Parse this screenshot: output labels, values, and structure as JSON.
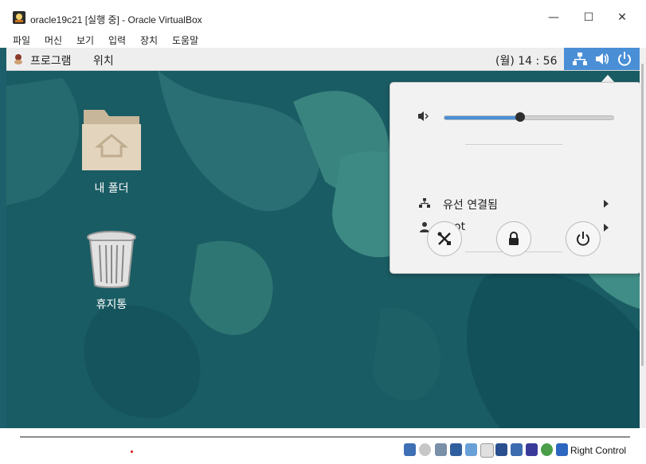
{
  "window": {
    "title": "oracle19c21 [실행 중] - Oracle VirtualBox",
    "controls": {
      "minimize": "—",
      "maximize": "☐",
      "close": "✕"
    }
  },
  "menubar": {
    "items": [
      "파일",
      "머신",
      "보기",
      "입력",
      "장치",
      "도움말"
    ]
  },
  "guest": {
    "topbar": {
      "apps_label": "프로그램",
      "places_label": "위치",
      "clock": "(월) 14 : 56"
    },
    "desktop": {
      "folder_label": "내 폴더",
      "trash_label": "휴지통"
    },
    "popup": {
      "volume_percent": 45,
      "network_label": "유선 연결됨",
      "user_label": "root",
      "buttons": [
        "settings-icon",
        "lock-icon",
        "power-icon"
      ]
    }
  },
  "statusbar": {
    "host_key": "Right Control"
  },
  "colors": {
    "accent": "#4a8fd6",
    "desktop": "#1d5f6a"
  }
}
